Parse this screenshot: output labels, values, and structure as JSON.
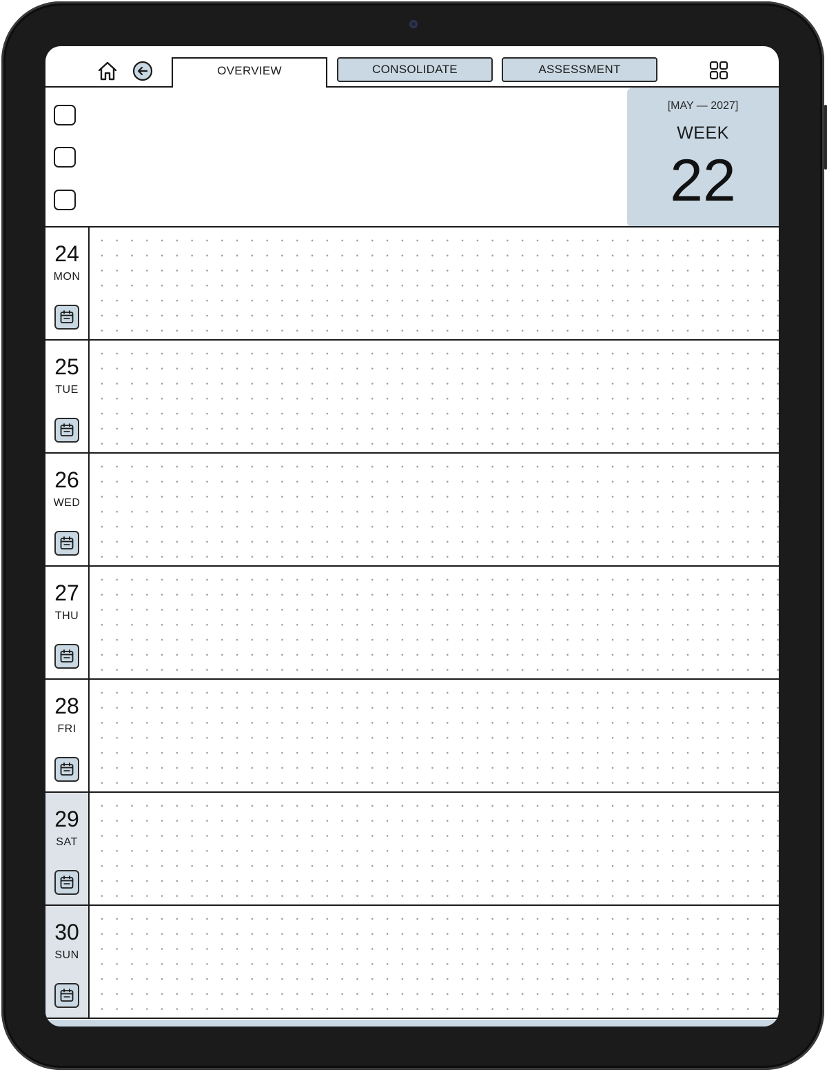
{
  "nav": {
    "tabs": [
      {
        "label": "OVERVIEW",
        "active": true
      },
      {
        "label": "CONSOLIDATE",
        "active": false
      },
      {
        "label": "ASSESSMENT",
        "active": false
      }
    ],
    "icons": [
      "home-icon",
      "back-arrow-icon",
      "grid-icon"
    ]
  },
  "week": {
    "month_label": "[MAY — 2027]",
    "week_label": "WEEK",
    "week_number": "22"
  },
  "days": [
    {
      "date": "24",
      "weekday": "MON",
      "weekend": false
    },
    {
      "date": "25",
      "weekday": "TUE",
      "weekend": false
    },
    {
      "date": "26",
      "weekday": "WED",
      "weekend": false
    },
    {
      "date": "27",
      "weekday": "THU",
      "weekend": false
    },
    {
      "date": "28",
      "weekday": "FRI",
      "weekend": false
    },
    {
      "date": "29",
      "weekday": "SAT",
      "weekend": true
    },
    {
      "date": "30",
      "weekday": "SUN",
      "weekend": true
    }
  ],
  "colors": {
    "accent": "#c9d8e2",
    "weekend": "#dde3e8",
    "ink": "#1a1a1a",
    "frame": "#1b1b1b"
  }
}
